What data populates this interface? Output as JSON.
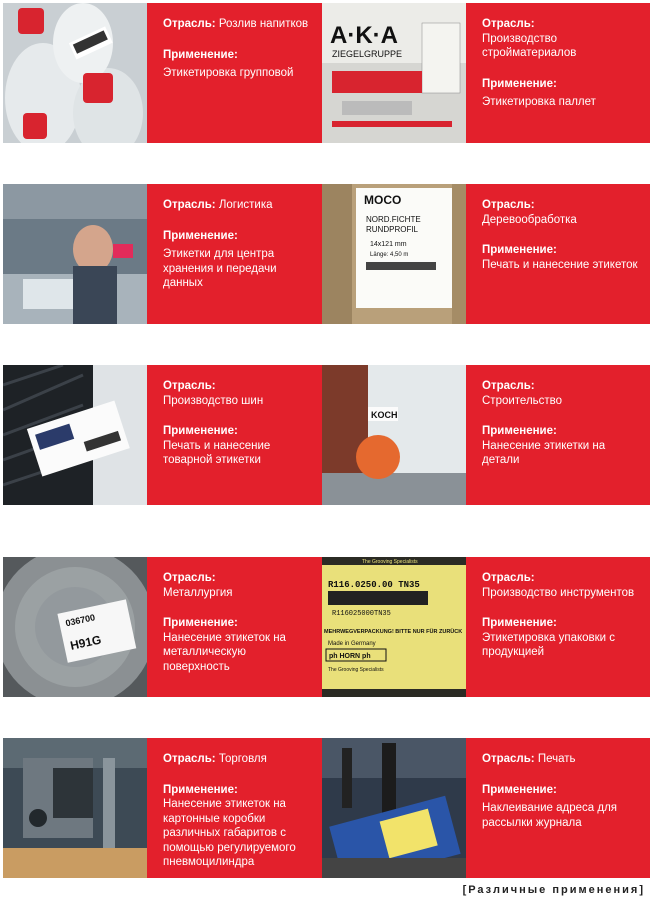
{
  "labels": {
    "industry": "Отрасль:",
    "application": "Применение:"
  },
  "cards": [
    {
      "industry": "Розлив напитков",
      "application": "Этикетировка групповой"
    },
    {
      "industry": "Производство стройматериалов",
      "application": "Этикетировка паллет"
    },
    {
      "industry": "Логистика",
      "application": "Этикетки для центра хранения и передачи данных"
    },
    {
      "industry": "Деревообработка",
      "application": "Печать и нанесение этикеток"
    },
    {
      "industry": "Производство шин",
      "application": "Печать и нанесение товарной этикетки"
    },
    {
      "industry": "Строительство",
      "application": "Нанесение этикетки на детали"
    },
    {
      "industry": "Металлургия",
      "application": "Нанесение этикеток на металлическую поверхность"
    },
    {
      "industry": "Производство инструментов",
      "application": "Этикетировка упаковки с продукцией"
    },
    {
      "industry": "Торговля",
      "application": "Нанесение этикеток на картонные коробки различных габаритов с помощью регулируемого пневмоцилиндра"
    },
    {
      "industry": "Печать",
      "application": "Наклеивание адреса для рассылки журнала"
    }
  ],
  "photo_text": {
    "aka_logo": "A·K·A",
    "aka_sub": "ZIEGELGRUPPE",
    "moco_brand": "MOCO",
    "moco_line1": "NORD.FICHTE",
    "moco_line2": "RUNDPROFIL",
    "moco_size": "14x121 mm",
    "moco_len": "Länge: 4,50 m",
    "koch_label": "KOCH",
    "tire_code": "H91G",
    "metal_code": "036700",
    "tool_code": "R116.0250.00 TN35",
    "tool_barcode_text": "R116025000TN35",
    "tool_line": "MEHRWEGVERPACKUNG! BITTE NUR FÜR ZURÜCK",
    "tool_made": "Made in Germany",
    "tool_brand": "ph HORN ph",
    "tool_slogan": "The Grooving Specialists"
  },
  "caption": "[Различные применения]",
  "colors": {
    "panel_red": "#e3202c"
  }
}
